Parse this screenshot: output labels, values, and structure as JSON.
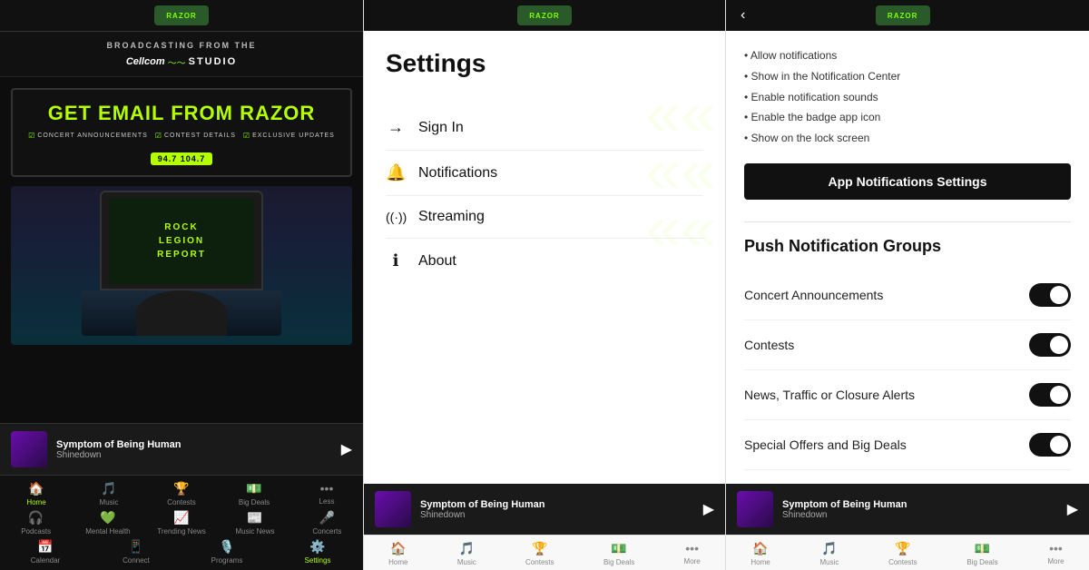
{
  "app": {
    "logo_text": "RAZOR",
    "station": "94.7 104.7"
  },
  "left_panel": {
    "top_bar": {
      "logo": "RAZOR"
    },
    "broadcasting": {
      "prefix": "BROADCASTING FROM THE",
      "brand": "Cellcom",
      "wave": "〜",
      "studio": "STUDIO"
    },
    "promo": {
      "title": "GET EMAIL FROM RAZOR",
      "items": [
        "CONCERT ANNOUNCEMENTS",
        "CONTEST DETAILS",
        "EXCLUSIVE UPDATES"
      ],
      "station_badge": "94.7  104.7"
    },
    "screen_content": "ROCK\nLEGION\nREPORT",
    "now_playing": {
      "track": "Symptom of Being Human",
      "artist": "Shinedown"
    },
    "nav": {
      "row1": [
        {
          "icon": "🏠",
          "label": "Home"
        },
        {
          "icon": "🎵",
          "label": "Music"
        },
        {
          "icon": "🏆",
          "label": "Contests"
        },
        {
          "icon": "💵",
          "label": "Big Deals"
        },
        {
          "icon": "•••",
          "label": "Less"
        }
      ],
      "row2": [
        {
          "icon": "🎧",
          "label": "Podcasts"
        },
        {
          "icon": "💚",
          "label": "Mental Health"
        },
        {
          "icon": "📈",
          "label": "Trending News"
        },
        {
          "icon": "📰",
          "label": "Music News"
        },
        {
          "icon": "🎤",
          "label": "Concerts"
        }
      ],
      "row3": [
        {
          "icon": "📅",
          "label": "Calendar"
        },
        {
          "icon": "📱",
          "label": "Connect"
        },
        {
          "icon": "🎙️",
          "label": "Programs"
        },
        {
          "icon": "⚙️",
          "label": "Settings"
        }
      ]
    }
  },
  "middle_panel": {
    "title": "Settings",
    "menu_items": [
      {
        "icon": "→",
        "label": "Sign In"
      },
      {
        "icon": "🔔",
        "label": "Notifications"
      },
      {
        "icon": "((·))",
        "label": "Streaming"
      },
      {
        "icon": "ℹ",
        "label": "About"
      }
    ],
    "now_playing": {
      "track": "Symptom of Being Human",
      "artist": "Shinedown"
    },
    "nav": [
      {
        "icon": "🏠",
        "label": "Home"
      },
      {
        "icon": "🎵",
        "label": "Music"
      },
      {
        "icon": "🏆",
        "label": "Contests"
      },
      {
        "icon": "💵",
        "label": "Big Deals"
      },
      {
        "icon": "•••",
        "label": "More"
      }
    ]
  },
  "right_panel": {
    "notification_items": [
      "Allow notifications",
      "Show in the Notification Center",
      "Enable notification sounds",
      "Enable the badge app icon",
      "Show on the lock screen"
    ],
    "app_notifications_btn": "App Notifications Settings",
    "push_groups_title": "Push Notification Groups",
    "push_groups": [
      {
        "label": "Concert Announcements",
        "enabled": true
      },
      {
        "label": "Contests",
        "enabled": true
      },
      {
        "label": "News, Traffic or Closure Alerts",
        "enabled": true
      },
      {
        "label": "Special Offers and Big Deals",
        "enabled": true
      }
    ],
    "now_playing": {
      "track": "Symptom of Being Human",
      "artist": "Shinedown"
    },
    "nav": [
      {
        "icon": "🏠",
        "label": "Home"
      },
      {
        "icon": "🎵",
        "label": "Music"
      },
      {
        "icon": "🏆",
        "label": "Contests"
      },
      {
        "icon": "💵",
        "label": "Big Deals"
      },
      {
        "icon": "•••",
        "label": "More"
      }
    ]
  }
}
